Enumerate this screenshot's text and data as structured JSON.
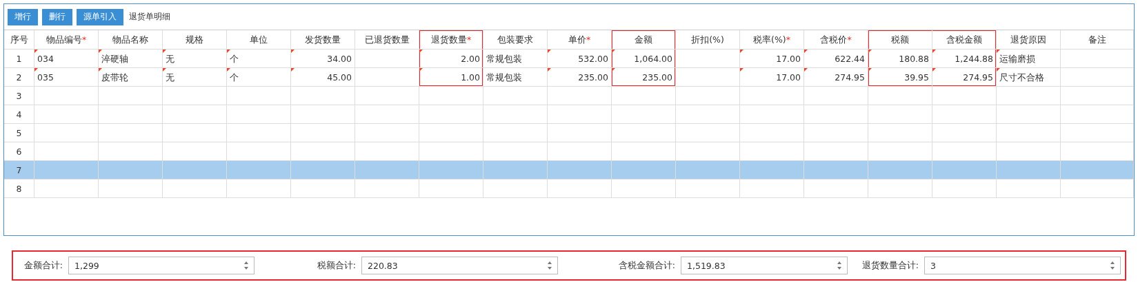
{
  "toolbar": {
    "buttons": [
      "增行",
      "删行",
      "源单引入"
    ],
    "title": "退货单明细"
  },
  "table": {
    "columns": [
      {
        "label": "序号",
        "kind": "index",
        "highlighted": false
      },
      {
        "label": "物品编号",
        "required_mark": "*",
        "kind": "text",
        "edit_marks": true,
        "highlighted": false
      },
      {
        "label": "物品名称",
        "kind": "text",
        "edit_marks": true,
        "highlighted": false
      },
      {
        "label": "规格",
        "kind": "text",
        "edit_marks": true,
        "highlighted": false
      },
      {
        "label": "单位",
        "kind": "text",
        "edit_marks": true,
        "highlighted": false
      },
      {
        "label": "发货数量",
        "kind": "number",
        "edit_marks": true,
        "highlighted": false
      },
      {
        "label": "已退货数量",
        "kind": "number",
        "edit_marks": false,
        "highlighted": false
      },
      {
        "label": "退货数量",
        "required_mark": "*",
        "kind": "number",
        "edit_marks": true,
        "highlighted": true
      },
      {
        "label": "包装要求",
        "kind": "text",
        "edit_marks": false,
        "highlighted": false
      },
      {
        "label": "单价",
        "required_mark": "*",
        "kind": "number",
        "edit_marks": true,
        "highlighted": false
      },
      {
        "label": "金额",
        "kind": "number",
        "edit_marks": true,
        "highlighted": true
      },
      {
        "label": "折扣(%)",
        "kind": "number",
        "edit_marks": false,
        "highlighted": false
      },
      {
        "label": "税率(%)",
        "required_mark": "*",
        "kind": "number",
        "edit_marks": true,
        "highlighted": false
      },
      {
        "label": "含税价",
        "required_mark": "*",
        "kind": "number",
        "edit_marks": true,
        "highlighted": false
      },
      {
        "label": "税额",
        "kind": "number",
        "edit_marks": true,
        "highlighted": true
      },
      {
        "label": "含税金额",
        "kind": "number",
        "edit_marks": true,
        "highlighted": true
      },
      {
        "label": "退货原因",
        "kind": "text",
        "edit_marks": true,
        "highlighted": false
      },
      {
        "label": "备注",
        "kind": "text",
        "edit_marks": false,
        "highlighted": false
      }
    ],
    "rows": [
      {
        "selected": false,
        "cells": [
          "1",
          "034",
          "淬硬轴",
          "无",
          "个",
          "34.00",
          null,
          "2.00",
          "常规包装",
          "532.00",
          "1,064.00",
          null,
          "17.00",
          "622.44",
          "180.88",
          "1,244.88",
          "运输磨损",
          null
        ]
      },
      {
        "selected": false,
        "cells": [
          "2",
          "035",
          "皮带轮",
          "无",
          "个",
          "45.00",
          null,
          "1.00",
          "常规包装",
          "235.00",
          "235.00",
          null,
          "17.00",
          "274.95",
          "39.95",
          "274.95",
          "尺寸不合格",
          null
        ]
      },
      {
        "selected": false,
        "cells": [
          "3"
        ]
      },
      {
        "selected": false,
        "cells": [
          "4"
        ]
      },
      {
        "selected": false,
        "cells": [
          "5"
        ]
      },
      {
        "selected": false,
        "cells": [
          "6"
        ]
      },
      {
        "selected": true,
        "cells": [
          "7"
        ]
      },
      {
        "selected": false,
        "cells": [
          "8"
        ]
      }
    ]
  },
  "totals": {
    "highlighted": true,
    "fields": [
      {
        "label": "金额合计:",
        "value": "1,299"
      },
      {
        "label": "税额合计:",
        "value": "220.83"
      },
      {
        "label": "含税金额合计:",
        "value": "1,519.83"
      },
      {
        "label": "退货数量合计:",
        "value": "3"
      }
    ]
  }
}
